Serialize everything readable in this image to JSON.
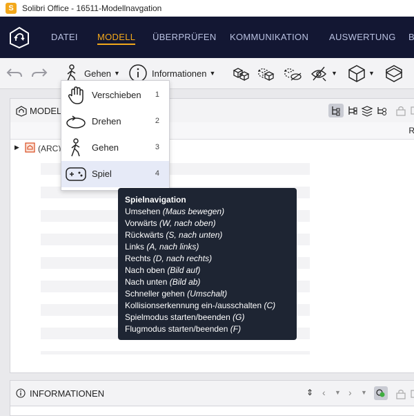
{
  "window": {
    "title": "Solibri Office - 16511-Modellnavgation",
    "logo_letter": "S"
  },
  "nav": {
    "items": [
      "DATEI",
      "MODELL",
      "ÜBERPRÜFEN",
      "KOMMUNIKATION",
      "AUSWERTUNG",
      "B"
    ],
    "active": "MODELL"
  },
  "toolbar": {
    "walk_label": "Gehen",
    "info_label": "Informationen"
  },
  "model_panel": {
    "title": "MODELL",
    "col_r": "R",
    "tree_item": "(ARC)"
  },
  "info_panel": {
    "title": "INFORMATIONEN"
  },
  "walk_menu": {
    "items": [
      {
        "label": "Verschieben",
        "key": "1",
        "icon": "hand-icon"
      },
      {
        "label": "Drehen",
        "key": "2",
        "icon": "rotate-icon"
      },
      {
        "label": "Gehen",
        "key": "3",
        "icon": "walk-icon"
      },
      {
        "label": "Spiel",
        "key": "4",
        "icon": "gamepad-icon"
      }
    ],
    "selected": "Spiel"
  },
  "tooltip": {
    "title": "Spielnavigation",
    "lines": [
      {
        "text": "Umsehen",
        "hint": "(Maus bewegen)"
      },
      {
        "text": "Vorwärts",
        "hint": "(W, nach oben)"
      },
      {
        "text": "Rückwärts",
        "hint": "(S, nach unten)"
      },
      {
        "text": "Links",
        "hint": "(A, nach links)"
      },
      {
        "text": "Rechts",
        "hint": "(D, nach rechts)"
      },
      {
        "text": "Nach oben",
        "hint": "(Bild auf)"
      },
      {
        "text": "Nach unten",
        "hint": "(Bild ab)"
      },
      {
        "text": "Schneller gehen",
        "hint": "(Umschalt)"
      },
      {
        "text": "Kollisionserkennung ein-/ausschalten",
        "hint": "(C)"
      },
      {
        "text": "Spielmodus starten/beenden",
        "hint": "(G)"
      },
      {
        "text": "Flugmodus starten/beenden",
        "hint": "(F)"
      }
    ]
  },
  "colors": {
    "nav_bg": "#131733",
    "accent": "#f3a81b",
    "tooltip_bg": "#1e2533"
  }
}
